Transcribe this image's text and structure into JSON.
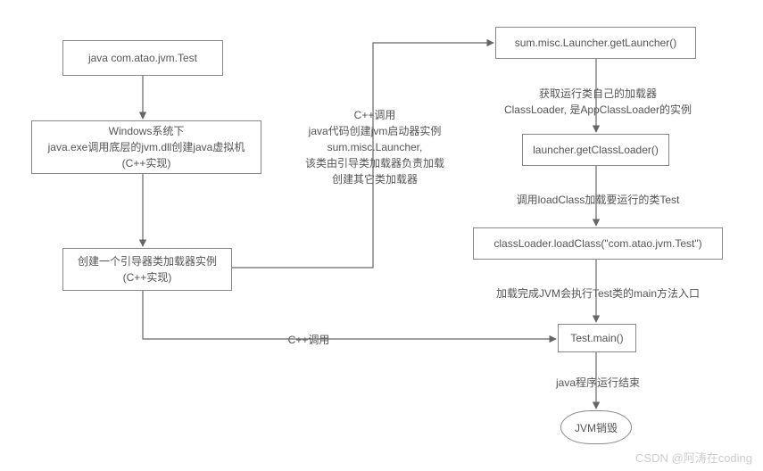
{
  "nodes": {
    "n1": "java com.atao.jvm.Test",
    "n2_line1": "Windows系统下",
    "n2_line2": "java.exe调用底层的jvm.dll创建java虚拟机",
    "n2_line3": "(C++实现)",
    "n3_line1": "创建一个引导器类加载器实例",
    "n3_line2": "(C++实现)",
    "n4": "sum.misc.Launcher.getLauncher()",
    "n5": "launcher.getClassLoader()",
    "n6": "classLoader.loadClass(\"com.atao.jvm.Test\")",
    "n7": "Test.main()",
    "n8": "JVM销毁"
  },
  "edges": {
    "e_cpp_right_line1": "C++调用",
    "e_cpp_right_line2": "java代码创建jvm启动器实例",
    "e_cpp_right_line3": "sum.misc.Launcher,",
    "e_cpp_right_line4": "该类由引导类加载器负责加载",
    "e_cpp_right_line5": "创建其它类加载器",
    "e4_5_line1": "获取运行类自己的加载器",
    "e4_5_line2": "ClassLoader, 是AppClassLoader的实例",
    "e5_6": "调用loadClass加载要运行的类Test",
    "e6_7": "加载完成JVM会执行Test类的main方法入口",
    "e3_7": "C++调用",
    "e7_8": "java程序运行结束"
  },
  "watermark": "CSDN @阿涛在coding"
}
